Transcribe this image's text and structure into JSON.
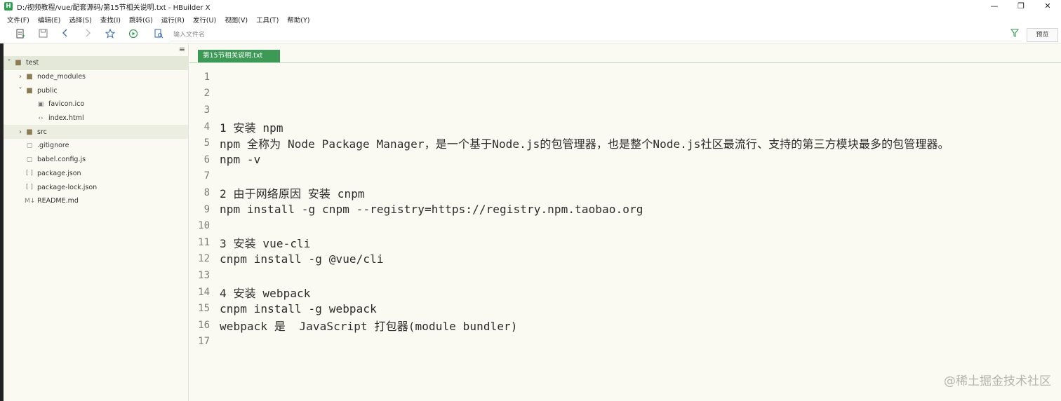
{
  "window": {
    "title": "D:/视频教程/vue/配套源码/第15节相关说明.txt - HBuilder X",
    "app_icon": "H",
    "controls": {
      "minimize": "—",
      "restore": "❐",
      "close": "✕"
    }
  },
  "menu": [
    "文件(F)",
    "编辑(E)",
    "选择(S)",
    "查找(I)",
    "跳转(G)",
    "运行(R)",
    "发行(U)",
    "视图(V)",
    "工具(T)",
    "帮助(Y)"
  ],
  "toolbar": {
    "file_input_placeholder": "输入文件名",
    "preview_label": "预览",
    "icons": [
      "new-file-icon",
      "save-icon",
      "back-icon",
      "forward-icon",
      "star-icon",
      "run-icon",
      "file-open-icon",
      "filter-icon"
    ]
  },
  "sidebar": {
    "collapse_glyph": "≡",
    "tree": [
      {
        "label": "test",
        "kind": "folder",
        "depth": 0,
        "arrow": "˅",
        "state": "selected"
      },
      {
        "label": "node_modules",
        "kind": "folder",
        "depth": 1,
        "arrow": "›"
      },
      {
        "label": "public",
        "kind": "folder",
        "depth": 1,
        "arrow": "˅"
      },
      {
        "label": "favicon.ico",
        "kind": "image",
        "depth": 2
      },
      {
        "label": "index.html",
        "kind": "html",
        "depth": 2
      },
      {
        "label": "src",
        "kind": "folder",
        "depth": 1,
        "arrow": "›",
        "state": "hover"
      },
      {
        "label": ".gitignore",
        "kind": "file",
        "depth": 1
      },
      {
        "label": "babel.config.js",
        "kind": "file",
        "depth": 1
      },
      {
        "label": "package.json",
        "kind": "json",
        "depth": 1
      },
      {
        "label": "package-lock.json",
        "kind": "json",
        "depth": 1
      },
      {
        "label": "README.md",
        "kind": "md",
        "depth": 1
      }
    ]
  },
  "editor": {
    "tab_label": "第15节相关说明.txt",
    "lines": [
      "",
      "",
      "",
      "1 安装 npm",
      "npm 全称为 Node Package Manager，是一个基于Node.js的包管理器，也是整个Node.js社区最流行、支持的第三方模块最多的包管理器。",
      "npm -v",
      "",
      "2 由于网络原因 安装 cnpm",
      "npm install -g cnpm --registry=https://registry.npm.taobao.org",
      "",
      "3 安装 vue-cli",
      "cnpm install -g @vue/cli",
      "",
      "4 安装 webpack",
      "cnpm install -g webpack",
      "webpack 是  JavaScript 打包器(module bundler)",
      ""
    ]
  },
  "watermark": "@稀土掘金技术社区",
  "colors": {
    "tab_green": "#3d9a56",
    "editor_bg": "#fafaf2"
  }
}
